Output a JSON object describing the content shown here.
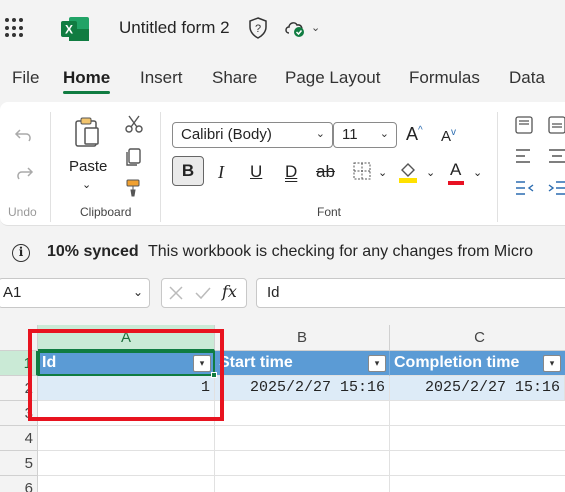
{
  "app": {
    "title": "Untitled form 2",
    "brand_color": "#107c41"
  },
  "menu": {
    "tabs": [
      {
        "label": "File"
      },
      {
        "label": "Home",
        "active": true
      },
      {
        "label": "Insert"
      },
      {
        "label": "Share"
      },
      {
        "label": "Page Layout"
      },
      {
        "label": "Formulas"
      },
      {
        "label": "Data"
      }
    ]
  },
  "ribbon": {
    "undo_group": {
      "label": "Undo"
    },
    "clipboard": {
      "label": "Clipboard",
      "paste_label": "Paste"
    },
    "font": {
      "label": "Font",
      "family": "Calibri (Body)",
      "size": "11",
      "bold": "B",
      "italic": "I",
      "underline": "U",
      "double_underline": "D",
      "strike": "ab",
      "font_color_accent": "#e81123",
      "highlight_accent": "#ffe100"
    }
  },
  "infobar": {
    "strong": "10% synced",
    "text": "This workbook is checking for any changes from Micro"
  },
  "formula_bar": {
    "name_box": "A1",
    "fx": "fx",
    "content": "Id"
  },
  "grid": {
    "columns": [
      "A",
      "B",
      "C"
    ],
    "rows": [
      "1",
      "2",
      "3",
      "4",
      "5",
      "6"
    ],
    "headers": [
      "Id",
      "Start time",
      "Completion time"
    ],
    "data_row": [
      "1",
      "2025/2/27 15:16",
      "2025/2/27 15:16"
    ],
    "header_fill": "#5b9bd5",
    "row_fill": "#ddebf7",
    "highlight_color": "#e8131f"
  }
}
